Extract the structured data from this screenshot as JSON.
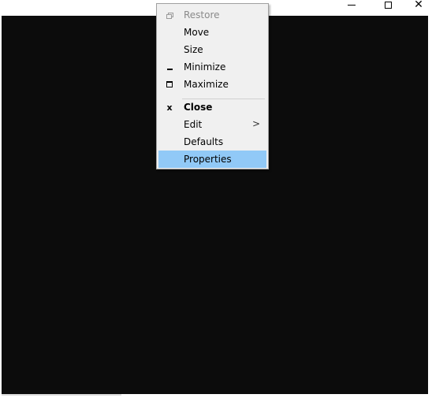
{
  "window": {
    "caption_buttons": {
      "minimize_icon": "minimize-icon",
      "maximize_icon": "maximize-icon",
      "close_glyph": "✕"
    },
    "console_bg": "#0c0c0c"
  },
  "system_menu": {
    "highlight_color": "#91c9f7",
    "items": [
      {
        "label": "Restore",
        "icon": "restore-icon",
        "disabled": true
      },
      {
        "label": "Move",
        "icon": "",
        "disabled": false
      },
      {
        "label": "Size",
        "icon": "",
        "disabled": false
      },
      {
        "label": "Minimize",
        "icon": "minimize-icon",
        "disabled": false
      },
      {
        "label": "Maximize",
        "icon": "maximize-icon",
        "disabled": false
      },
      {
        "label": "Close",
        "icon": "close-icon",
        "icon_glyph": "x",
        "bold": true
      },
      {
        "label": "Edit",
        "icon": "",
        "submenu_arrow": ">"
      },
      {
        "label": "Defaults",
        "icon": ""
      },
      {
        "label": "Properties",
        "icon": "",
        "highlighted": true
      }
    ]
  }
}
